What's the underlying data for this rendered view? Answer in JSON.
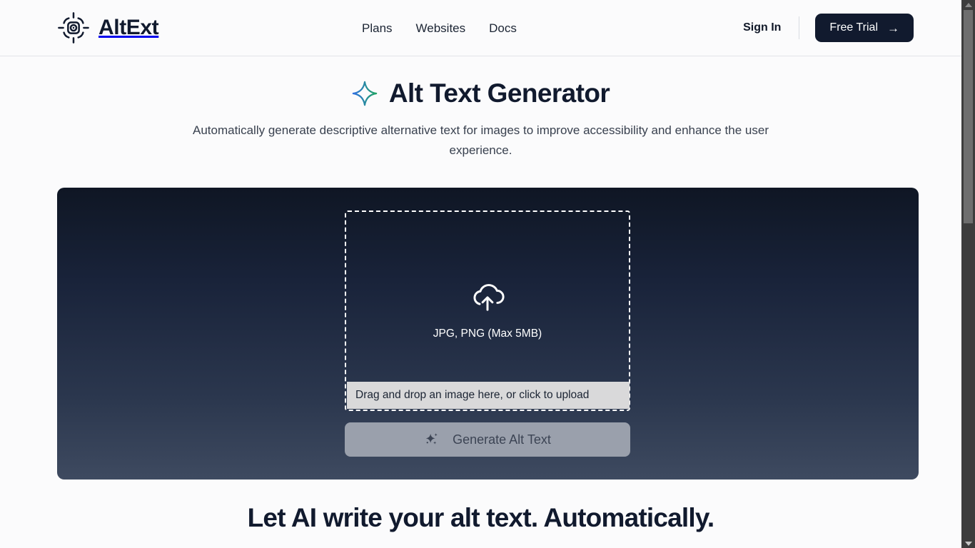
{
  "header": {
    "brand": {
      "name": "AltExt",
      "icon": "scan-camera-icon"
    },
    "nav": [
      {
        "label": "Plans",
        "name": "nav-plans"
      },
      {
        "label": "Websites",
        "name": "nav-websites"
      },
      {
        "label": "Docs",
        "name": "nav-docs"
      }
    ],
    "sign_in_label": "Sign In",
    "cta_label": "Free Trial",
    "cta_arrow": "→",
    "cta_bg": "#111a2e"
  },
  "hero": {
    "sparkle_icon": "sparkle-icon",
    "title": "Alt Text Generator",
    "subtitle": "Automatically generate descriptive alternative text for images to improve accessibility and enhance the user experience.",
    "sparkle_gradient_from": "#2f6fe0",
    "sparkle_gradient_to": "#1fa463"
  },
  "uploader": {
    "card_gradient_top": "#0f1624",
    "card_gradient_bottom": "#3e4a60",
    "cloud_icon": "cloud-upload-icon",
    "formats_label": "JPG, PNG (Max 5MB)",
    "tooltip_label": "Drag and drop an image here, or click to upload",
    "generate_label": "Generate Alt Text",
    "generate_icon": "sparkles-icon",
    "generate_disabled_bg": "#9aa0ac"
  },
  "bottom": {
    "headline": "Let AI write your alt text. Automatically."
  },
  "scrollbar": {
    "up_arrow": "▲",
    "down_arrow": "▼"
  }
}
